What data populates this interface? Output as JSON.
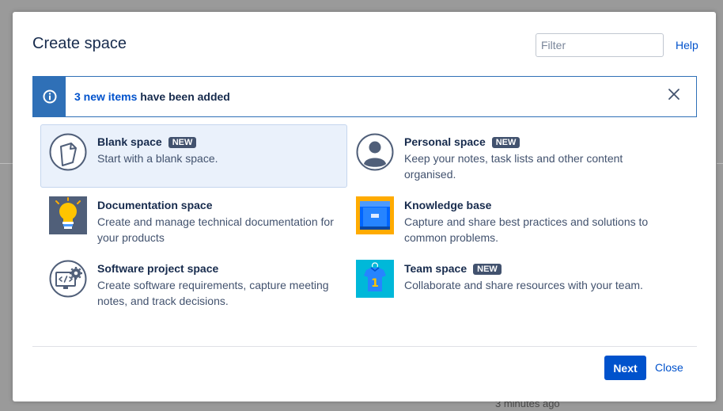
{
  "background": {
    "partial_text": "3 minutes ago"
  },
  "dialog": {
    "title": "Create space",
    "filter": {
      "placeholder": "Filter",
      "value": ""
    },
    "help_label": "Help",
    "banner": {
      "link_text": "3 new items",
      "text": " have been added",
      "info_icon": "info-icon",
      "close_icon": "close-icon"
    },
    "templates": [
      {
        "id": "blank",
        "name": "Blank space",
        "badge": "NEW",
        "description": "Start with a blank space.",
        "icon": "blank-page-icon",
        "selected": true
      },
      {
        "id": "personal",
        "name": "Personal space",
        "badge": "NEW",
        "description": "Keep your notes, task lists and other content organised.",
        "icon": "person-icon",
        "selected": false
      },
      {
        "id": "documentation",
        "name": "Documentation space",
        "badge": "",
        "description": "Create and manage technical documentation for your products",
        "icon": "lightbulb-icon",
        "selected": false
      },
      {
        "id": "knowledge",
        "name": "Knowledge base",
        "badge": "",
        "description": "Capture and share best practices and solutions to common problems.",
        "icon": "folder-icon",
        "selected": false
      },
      {
        "id": "software",
        "name": "Software project space",
        "badge": "",
        "description": "Create software requirements, capture meeting notes, and track decisions.",
        "icon": "code-gear-icon",
        "selected": false
      },
      {
        "id": "team",
        "name": "Team space",
        "badge": "NEW",
        "description": "Collaborate and share resources with your team.",
        "icon": "team-jersey-icon",
        "selected": false
      }
    ],
    "buttons": {
      "next": "Next",
      "close": "Close"
    }
  },
  "colors": {
    "accent": "#0052cc",
    "banner_border": "#2f70b7",
    "selected_tile": "#eaf1fb",
    "badge": "#42526e"
  }
}
